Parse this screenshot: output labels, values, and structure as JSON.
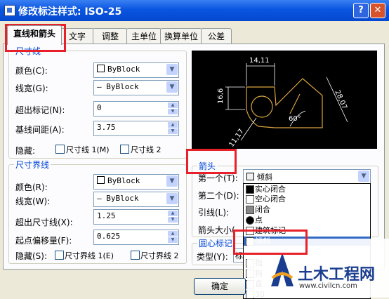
{
  "window": {
    "title": "修改标注样式: ISO-25",
    "help_label": "?",
    "close_label": "✕"
  },
  "tabs": [
    "直线和箭头",
    "文字",
    "调整",
    "主单位",
    "换算单位",
    "公差"
  ],
  "dim_lines": {
    "group_title": "尺寸线",
    "color_label": "颜色(C):",
    "color_value": "ByBlock",
    "lineweight_label": "线宽(G):",
    "lineweight_value": "— ByBlock",
    "extend_label": "超出标记(N):",
    "extend_value": "0",
    "baseline_label": "基线间距(A):",
    "baseline_value": "3.75",
    "suppress_label": "隐藏:",
    "suppress1": "尺寸线 1(M)",
    "suppress2": "尺寸线 2"
  },
  "ext_lines": {
    "group_title": "尺寸界线",
    "color_label": "颜色(R):",
    "color_value": "ByBlock",
    "lineweight_label": "线宽(W):",
    "lineweight_value": "— ByBlock",
    "extend_label": "超出尺寸线(X):",
    "extend_value": "1.25",
    "offset_label": "起点偏移量(F):",
    "offset_value": "0.625",
    "suppress_label": "隐藏(S):",
    "suppress1": "尺寸界线 1(E)",
    "suppress2": "尺寸界线 2"
  },
  "preview": {
    "dim_top": "14,11",
    "dim_left": "16,6",
    "dim_right": "28,07",
    "dim_bottom": "11,17",
    "dim_angle": "60°"
  },
  "arrows": {
    "group_title": "箭头",
    "first_label": "第一个(T):",
    "first_value": "倾斜",
    "second_label": "第二个(D):",
    "leader_label": "引线(L):",
    "size_label": "箭头大小(",
    "options": [
      "实心闭合",
      "空心闭合",
      "闭合",
      "点",
      "建筑标记",
      "倾斜",
      "指",
      "指",
      "直",
      "30"
    ]
  },
  "center_mark": {
    "group_title": "圆心标记",
    "type_label": "类型(Y):",
    "type_value": "标"
  },
  "buttons": {
    "ok": "确定"
  },
  "watermark": {
    "name": "土木工程网",
    "url": "www.civilcn.com"
  },
  "colors": {
    "highlight": "#e8202a",
    "preview_lines": "#d9a441",
    "dim_text": "#ffffff"
  }
}
